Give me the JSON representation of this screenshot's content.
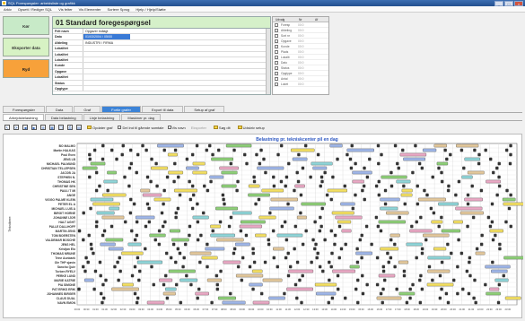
{
  "window": {
    "title": "SQL Forespørgsler: arbeidsliste og grafikk"
  },
  "menu": [
    "Arkiv",
    "Opsett / Rediger SQL",
    "Vis felter",
    "Vis Elementer",
    "Sortere Sprog",
    "Hjelp / Hjelp/Støtte"
  ],
  "left_buttons": [
    "Kør",
    "Eksporter data",
    "Ryd"
  ],
  "form": {
    "title": "01 Standard foregespørgsel",
    "rows": [
      {
        "label": "Felt navn",
        "value": "Opgaver indlagt"
      },
      {
        "label": "Dato",
        "value": "01/03/2004 / 05/00",
        "selected": true
      },
      {
        "label": "Afdeling",
        "value": "INDUSTRI / FIRMA"
      },
      {
        "label": "Lokalitet",
        "value": ""
      },
      {
        "label": "Lokalitet",
        "value": ""
      },
      {
        "label": "Lokalitet",
        "value": ""
      },
      {
        "label": "Kunde",
        "value": ""
      },
      {
        "label": "Opgave",
        "value": ""
      },
      {
        "label": "Lokalitet",
        "value": ""
      },
      {
        "label": "Status",
        "value": ""
      },
      {
        "label": "Opgtype",
        "value": ""
      }
    ]
  },
  "right_panel": {
    "headers": [
      "Udvalg",
      "Nr",
      "Af"
    ],
    "rows": [
      {
        "name": "Foresp",
        "val": "00:0"
      },
      {
        "name": "Afdeling",
        "val": "00:0"
      },
      {
        "name": "Sort nr",
        "val": "00:0"
      },
      {
        "name": "Opgave",
        "val": "00:0"
      },
      {
        "name": "Kunde",
        "val": "00:0"
      },
      {
        "name": "Plads",
        "val": "00:0"
      },
      {
        "name": "Lokalit",
        "val": "00:0"
      },
      {
        "name": "Dato",
        "val": "00:0"
      },
      {
        "name": "Status",
        "val": "00:0"
      },
      {
        "name": "Opgtype",
        "val": "00:0"
      },
      {
        "name": "Antal",
        "val": "00:0"
      },
      {
        "name": "Loket",
        "val": "00:0"
      }
    ]
  },
  "tabs_main": [
    {
      "label": "Forespørgsler",
      "active": false
    },
    {
      "label": "Data",
      "active": false
    },
    {
      "label": "Graf",
      "active": false
    },
    {
      "label": "Fortle grafer",
      "active": true
    },
    {
      "label": "Export til data",
      "active": false
    },
    {
      "label": "Setup af graf",
      "active": false
    }
  ],
  "tabs_sub": [
    {
      "label": "Arbejdsbelastning",
      "active": true
    },
    {
      "label": "Data belastning",
      "active": false
    },
    {
      "label": "Linje belastning",
      "active": false
    },
    {
      "label": "Maskiner pr. dag",
      "active": false
    }
  ],
  "toolbar": {
    "buttons_label": "Opdater graf",
    "check1": "Del ind til gående samtale",
    "check2": "Vis navn",
    "btn_export": "Eksporter",
    "btn_search": "Søg dit",
    "btn_setup": "Udskriv setup"
  },
  "chart_data": {
    "type": "timeline",
    "title": "Belastning pr. tekniskcenter pil en dag",
    "ylabel": "Teknikere",
    "rows": [
      "BO MALMO",
      "Martin HALKAS",
      "Poul Even",
      "JENS LB",
      "MICHAEL PALMUND",
      "CHRISTIAN TELLEPSEN",
      "JACOB JA",
      "STEPHEN N.",
      "THOMAS HK",
      "CHRISTINE SEN",
      "PAULI T MI",
      "ANGE",
      "VIGGO PALME KLEIN",
      "PETER EL A",
      "MICHAEL LUIS A",
      "BIRGIT HORNE",
      "JOHANNE IJOR",
      "HALT AGHT",
      "PALLE DALLHOFF",
      "MARTIN JENS",
      "TOM BOERSTEN",
      "VALDEMAR BOSCHE",
      "JENS HEL",
      "Kristjan Elo",
      "THOMAS MRUNE",
      "Trine Aunbaek",
      "Ole THP sjøvin",
      "Sancho Quie",
      "Torben RYELV",
      "PERKE LUND",
      "MARIE KATRIE",
      "PIA SIMONE",
      "PAT ERIKS ERIK",
      "JOHANNES BIRGER",
      "CLAUS DUAL",
      "NAVN EMON"
    ],
    "x_ticks": [
      "00:00",
      "00:30",
      "01:00",
      "01:30",
      "02:00",
      "02:30",
      "03:00",
      "03:30",
      "04:00",
      "04:30",
      "05:00",
      "05:30",
      "06:00",
      "06:30",
      "07:00",
      "07:30",
      "08:00",
      "08:30",
      "09:00",
      "09:30",
      "10:00",
      "10:30",
      "11:00",
      "11:30",
      "12:00",
      "12:30",
      "13:00",
      "13:30",
      "14:00",
      "14:30",
      "15:00",
      "15:30",
      "16:00",
      "16:30",
      "17:00",
      "17:30",
      "18:00",
      "18:30",
      "19:00",
      "19:30",
      "20:00",
      "20:30",
      "21:00",
      "21:30",
      "22:00",
      "22:30",
      "23:00",
      "23:30"
    ],
    "x_range": [
      0,
      24
    ],
    "grid": true,
    "colors": {
      "yellow": "#f3df62",
      "green": "#8ecf78",
      "blue": "#9fb6e8",
      "pink": "#e9a8c4",
      "tan": "#e3c89b",
      "cyan": "#8fd5d8",
      "dark": "#333333"
    }
  }
}
